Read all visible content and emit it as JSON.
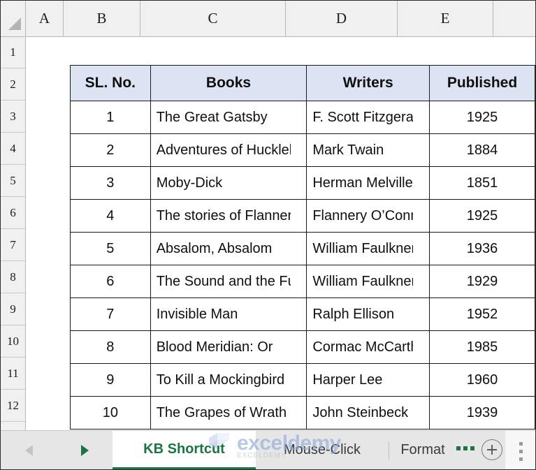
{
  "spreadsheet": {
    "column_headers": [
      "A",
      "B",
      "C",
      "D",
      "E"
    ],
    "row_headers": [
      "1",
      "2",
      "3",
      "4",
      "5",
      "6",
      "7",
      "8",
      "9",
      "10",
      "11",
      "12"
    ],
    "select_all_corner": "select-all-triangle"
  },
  "table": {
    "headers": [
      "SL. No.",
      "Books",
      "Writers",
      "Published"
    ],
    "header_fill": "#dce3f2",
    "border_color": "#1a1a1a",
    "rows": [
      {
        "sl": "1",
        "book": "The Great Gatsby",
        "writer": "F. Scott Fitzgerald",
        "year": "1925"
      },
      {
        "sl": "2",
        "book": "Adventures of Huckleberry Finn",
        "writer": "Mark Twain",
        "year": "1884"
      },
      {
        "sl": "3",
        "book": "Moby-Dick",
        "writer": "Herman Melville",
        "year": "1851"
      },
      {
        "sl": "4",
        "book": "The stories of Flannery",
        "writer": "Flannery O’Connor",
        "year": "1925"
      },
      {
        "sl": "5",
        "book": "Absalom, Absalom",
        "writer": "William Faulkner",
        "year": "1936"
      },
      {
        "sl": "6",
        "book": "The Sound and the Fury",
        "writer": "William Faulkner",
        "year": "1929"
      },
      {
        "sl": "7",
        "book": "Invisible Man",
        "writer": "Ralph Ellison",
        "year": "1952"
      },
      {
        "sl": "8",
        "book": "Blood Meridian: Or",
        "writer": "Cormac McCarthy",
        "year": "1985"
      },
      {
        "sl": "9",
        "book": "To Kill a Mockingbird",
        "writer": "Harper Lee",
        "year": "1960"
      },
      {
        "sl": "10",
        "book": "The Grapes of Wrath",
        "writer": "John Steinbeck",
        "year": "1939"
      }
    ]
  },
  "tabbar": {
    "nav_prev": "previous-sheet-arrow",
    "nav_next": "next-sheet-arrow",
    "tabs": [
      {
        "label": "KB Shortcut",
        "active": true
      },
      {
        "label": "Mouse-Click",
        "active": false
      },
      {
        "label": "Format",
        "active": false
      }
    ],
    "overflow_label": "...",
    "add_sheet": "new-sheet-button",
    "more_options": "more-options-kebab",
    "active_tab_color": "#217346"
  },
  "watermark": {
    "text": "exceldemy",
    "subtext": "EXCELDEMY"
  }
}
